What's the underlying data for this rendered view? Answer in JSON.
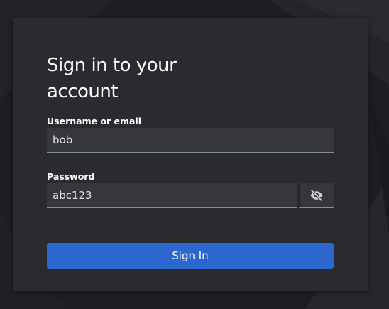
{
  "login": {
    "title": "Sign in to your account",
    "username": {
      "label": "Username or email",
      "value": "bob"
    },
    "password": {
      "label": "Password",
      "value": "abc123",
      "toggle_icon": "eye-slash-icon"
    },
    "submit_label": "Sign In"
  },
  "colors": {
    "background": "#1b1c1f",
    "card": "#2a2b2f",
    "field": "#36373b",
    "primary": "#2b67cf",
    "text": "#ffffff"
  }
}
